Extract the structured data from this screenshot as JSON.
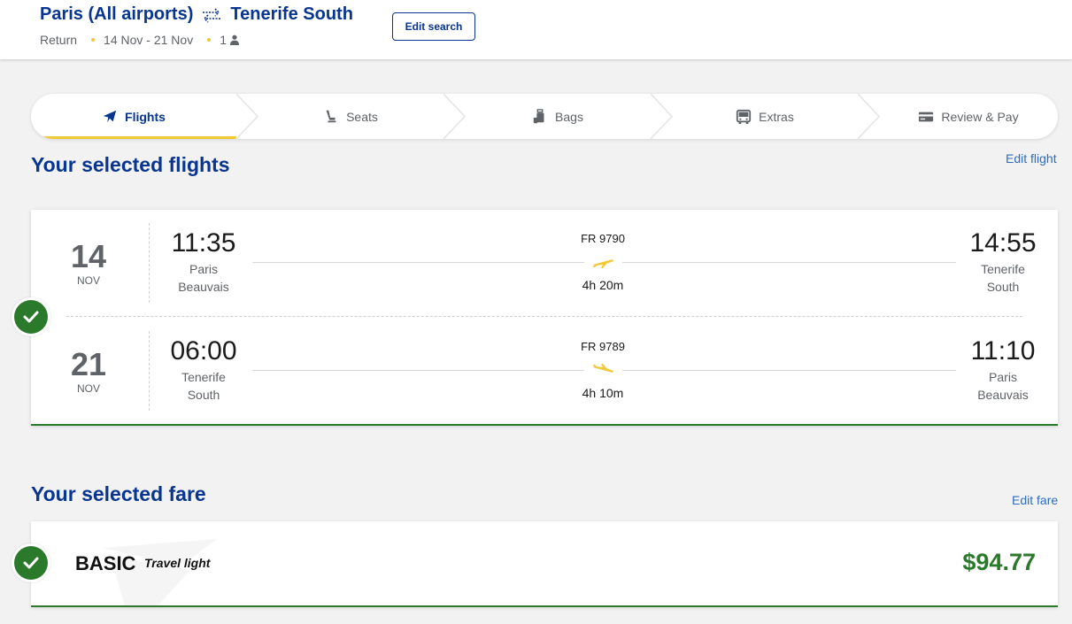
{
  "header": {
    "origin": "Paris (All airports)",
    "destination": "Tenerife South",
    "trip_type": "Return",
    "dates": "14 Nov - 21 Nov",
    "passengers": "1",
    "edit_search_label": "Edit search"
  },
  "steps": [
    {
      "label": "Flights",
      "icon": "plane-icon",
      "active": true
    },
    {
      "label": "Seats",
      "icon": "seat-icon",
      "active": false
    },
    {
      "label": "Bags",
      "icon": "bag-icon",
      "active": false
    },
    {
      "label": "Extras",
      "icon": "bus-icon",
      "active": false
    },
    {
      "label": "Review & Pay",
      "icon": "card-icon",
      "active": false
    }
  ],
  "flights_section": {
    "title": "Your selected flights",
    "edit_label": "Edit flight",
    "legs": [
      {
        "day": "14",
        "month": "NOV",
        "dep_time": "11:35",
        "dep_city_1": "Paris",
        "dep_city_2": "Beauvais",
        "flight_no": "FR 9790",
        "duration": "4h 20m",
        "arr_time": "14:55",
        "arr_city_1": "Tenerife",
        "arr_city_2": "South"
      },
      {
        "day": "21",
        "month": "NOV",
        "dep_time": "06:00",
        "dep_city_1": "Tenerife",
        "dep_city_2": "South",
        "flight_no": "FR 9789",
        "duration": "4h 10m",
        "arr_time": "11:10",
        "arr_city_1": "Paris",
        "arr_city_2": "Beauvais"
      }
    ]
  },
  "fare_section": {
    "title": "Your selected fare",
    "edit_label": "Edit fare",
    "fare_name": "BASIC",
    "fare_tag": "Travel light",
    "price": "$94.77"
  },
  "colors": {
    "brand_blue": "#073590",
    "accent_yellow": "#f1c933",
    "success_green": "#2b7a2b",
    "link_blue": "#2d6cc0"
  }
}
